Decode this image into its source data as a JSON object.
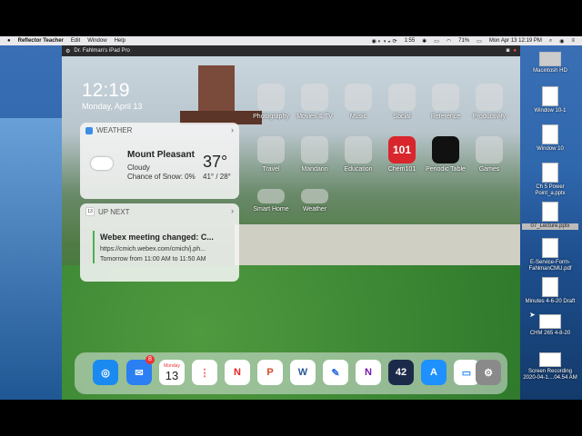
{
  "menubar": {
    "app_name": "Reflector Teacher",
    "menus": [
      "Edit",
      "Window",
      "Help"
    ],
    "time_small": "1:55",
    "battery": "71%",
    "clock": "Mon Apr 13  12:19 PM"
  },
  "ipad_title": "Dr. Fahlman's iPad Pro",
  "lock": {
    "time": "12:19",
    "date": "Monday, April 13"
  },
  "weather": {
    "header": "WEATHER",
    "location": "Mount Pleasant",
    "condition": "Cloudy",
    "snow": "Chance of Snow: 0%",
    "temp": "37°",
    "range": "41° / 28°"
  },
  "upnext": {
    "day": "13",
    "header": "UP NEXT",
    "title": "Webex meeting changed: C...",
    "url": "https://cmich.webex.com/cmich/j.ph...",
    "time": "Tomorrow from 11:00 AM to 11:50 AM"
  },
  "apps_row1": [
    "Photography",
    "Movies & TV",
    "Music",
    "Social",
    "Reference",
    "Productivity"
  ],
  "apps_row2": [
    "Travel",
    "Mandarin",
    "Education",
    "Chem101",
    "Periodic Table",
    "Games"
  ],
  "apps_row3": [
    "Smart Home",
    "Weather"
  ],
  "chem101_badge": "101",
  "dock": {
    "mail_badge": "8",
    "calendar_day": "Monday",
    "calendar_num": "13",
    "num42": "42"
  },
  "desktop_files": [
    "Macintosh HD",
    "Window 10-1",
    "Window 10",
    "Ch 5 Power Point_a.pptx",
    "07_Lecture.pptx",
    "E-Service-Form-FahlmanCMU.pdf",
    "Minutes 4-6-20 Draft",
    "CHM 265 4-8-20",
    "Screen Recording 2020-04-1....04.54 AM"
  ]
}
